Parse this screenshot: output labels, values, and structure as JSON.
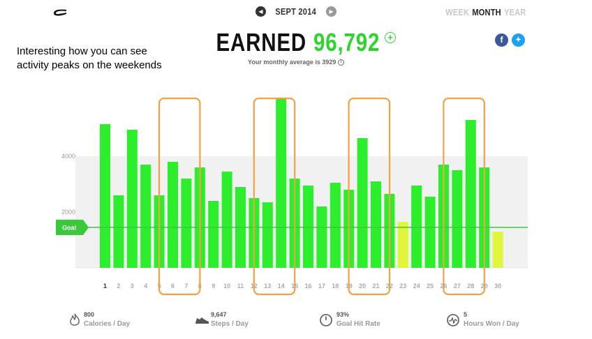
{
  "header": {
    "month_label": "SEPT 2014",
    "prev_icon": "triangle-left-icon",
    "next_icon": "triangle-right-icon",
    "periods": [
      "WEEK",
      "MONTH",
      "YEAR"
    ],
    "active_period": "MONTH"
  },
  "summary": {
    "earned_label": "EARNED",
    "earned_value": "96,792",
    "average_text": "Your monthly average is 3929"
  },
  "annotation": {
    "text": "Interesting how you can see activity peaks on the weekends",
    "highlight_color": "#f5a042",
    "highlighted_days": [
      [
        6,
        7
      ],
      [
        13,
        14
      ],
      [
        20,
        21
      ],
      [
        27,
        28
      ]
    ]
  },
  "colors": {
    "bar_green": "#2cee2c",
    "bar_yellow": "#e1f53a",
    "goal_line": "#3ac93a",
    "accent": "#2ed32e"
  },
  "chart_data": {
    "type": "bar",
    "x": [
      1,
      2,
      3,
      4,
      5,
      6,
      7,
      8,
      9,
      10,
      11,
      12,
      13,
      14,
      15,
      16,
      17,
      18,
      19,
      20,
      21,
      22,
      23,
      24,
      25,
      26,
      27,
      28,
      29,
      30
    ],
    "values": [
      5150,
      2600,
      4950,
      3700,
      2600,
      3800,
      3200,
      3600,
      2400,
      3450,
      2900,
      2500,
      2350,
      6050,
      3200,
      2950,
      2200,
      3050,
      2800,
      4650,
      3100,
      2650,
      1650,
      2950,
      2550,
      3700,
      3500,
      5300,
      3600,
      1300
    ],
    "bar_colors": [
      "green",
      "green",
      "green",
      "green",
      "green",
      "green",
      "green",
      "green",
      "green",
      "green",
      "green",
      "green",
      "green",
      "green",
      "green",
      "green",
      "green",
      "green",
      "green",
      "green",
      "green",
      "green",
      "yellow",
      "green",
      "green",
      "green",
      "green",
      "green",
      "green",
      "yellow"
    ],
    "yticks": [
      2000,
      4000
    ],
    "ylim": [
      0,
      6100
    ],
    "goal_label": "Goal",
    "goal_value": 2000,
    "band": [
      0,
      4000
    ],
    "xlabel": "",
    "ylabel": "",
    "title": ""
  },
  "stats": [
    {
      "value": "800",
      "label": "Calories / Day",
      "icon": "flame-icon"
    },
    {
      "value": "9,647",
      "label": "Steps / Day",
      "icon": "shoe-icon"
    },
    {
      "value": "93%",
      "label": "Goal Hit Rate",
      "icon": "clock-icon"
    },
    {
      "value": "5",
      "label": "Hours Won / Day",
      "icon": "pulse-icon"
    }
  ]
}
